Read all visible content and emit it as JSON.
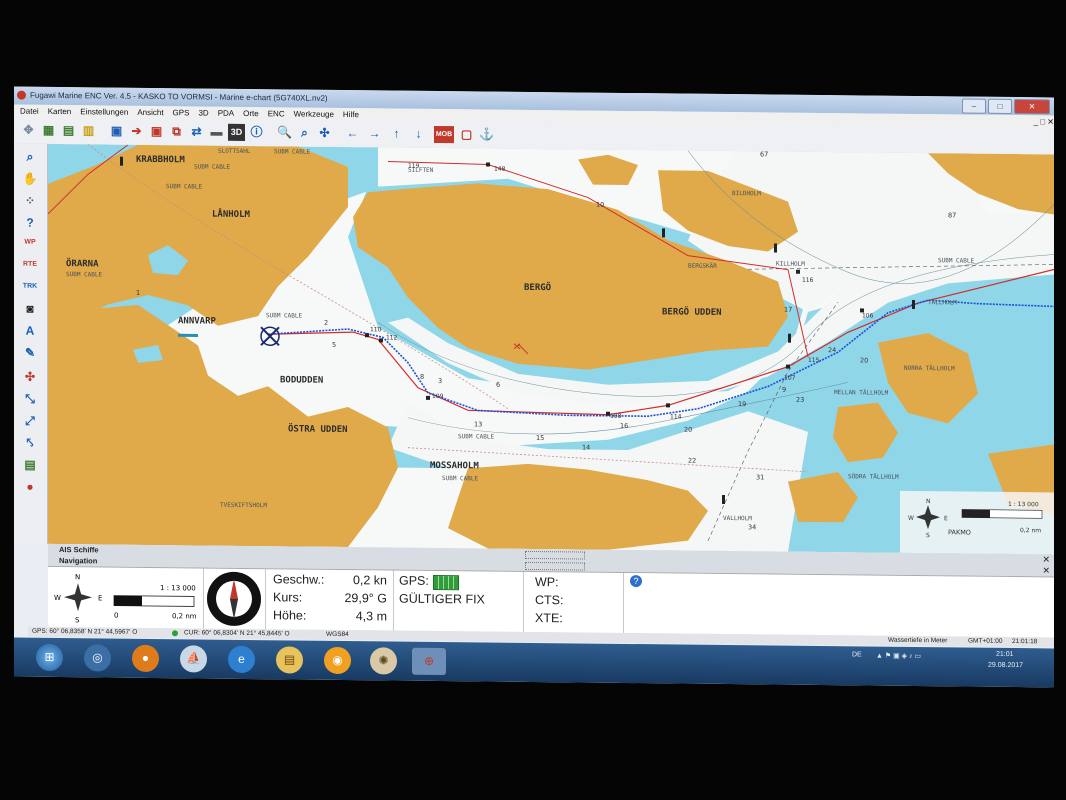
{
  "window": {
    "title": "Fugawi Marine ENC Ver. 4.5 - KASKO TO VORMSI - Marine e-chart  (5G740XL.nv2)",
    "controls": [
      "–",
      "□",
      "✕"
    ]
  },
  "menu": {
    "items": [
      "Datei",
      "Karten",
      "Einstellungen",
      "Ansicht",
      "GPS",
      "3D",
      "PDA",
      "Orte",
      "ENC",
      "Werkzeuge",
      "Hilfe"
    ],
    "right_controls": "_ □ ✕"
  },
  "toolbar": {
    "label_3d": "3D",
    "label_mob": "MOB"
  },
  "left_tools": {
    "wp": "WP",
    "rte": "RTE",
    "trk": "TRK",
    "text_tool": "A"
  },
  "chart": {
    "place_names": {
      "krabbholm": "KRABBHOLM",
      "lanholm": "LÅNHOLM",
      "orarna": "ÖRARNA",
      "annvarp": "ANNVARP",
      "bodudden": "BODUDDEN",
      "ostra_udden": "ÖSTRA UDDEN",
      "bergo": "BERGÖ",
      "bergo_udden": "BERGÖ UDDEN",
      "mossaholm": "MOSSAHOLM",
      "norra_tallholm": "NORRA TÄLLHOLM",
      "mellan_tallholm": "MELLAN TÄLLHOLM",
      "sodra_tallholm": "SÖDRA TÄLLHOLM",
      "tveskiftsholm": "TVESKIFTSHOLM",
      "vallholm": "VALLHOLM",
      "sloitsahl": "SLOTTSAHL",
      "silften": "SILFTEN",
      "bildholm": "BILDHOLM",
      "bergskar": "BERGSKÄR",
      "killholm": "KILLHOLM",
      "tallholm": "TÄLLHOLM"
    },
    "cable": "SUBM CABLE",
    "waypoints": [
      "110",
      "112",
      "109",
      "108",
      "106",
      "114",
      "107",
      "115",
      "116",
      "148",
      "119"
    ],
    "depths": [
      "1",
      "2",
      "3",
      "5",
      "6",
      "8",
      "9",
      "10",
      "13",
      "14",
      "15",
      "16",
      "17",
      "19",
      "20",
      "22",
      "23",
      "24",
      "26",
      "31",
      "34",
      "67",
      "87"
    ]
  },
  "inset": {
    "scale": "1 : 13 000",
    "distance": "0,2 nm",
    "watermark": "PAKMO",
    "compass_n": "N",
    "compass_s": "S",
    "compass_w": "W",
    "compass_e": "E"
  },
  "ais_panel": {
    "title": "AIS Schiffe"
  },
  "navigation_panel": {
    "title": "Navigation",
    "scale": "1 : 13 000",
    "scale_min": "0",
    "scale_max": "0,2 nm",
    "compass_n": "N",
    "compass_s": "S",
    "compass_w": "W",
    "compass_e": "E",
    "speed_label": "Geschw.:",
    "speed_value": "0,2 kn",
    "course_label": "Kurs:",
    "course_value": "29,9° G",
    "altitude_label": "Höhe:",
    "altitude_value": "4,3 m",
    "gps_label": "GPS:",
    "gps_status": "GÜLTIGER FIX",
    "wp_label": "WP:",
    "cts_label": "CTS:",
    "xte_label": "XTE:",
    "help": "?"
  },
  "status_bar": {
    "gps": "GPS: 60° 06,8358' N 21° 44,5967' O",
    "cursor": "CUR: 60° 06,8304' N 21° 45,8445' O",
    "datum": "WGS84",
    "depth_unit": "Wassertiefe in Meter",
    "timezone": "GMT+01:00",
    "time": "21:01:18"
  },
  "taskbar": {
    "language": "DE",
    "clock_time": "21:01",
    "clock_date": "29.08.2017"
  },
  "colors": {
    "land": "#e0a94a",
    "shallow": "#7fd0e4",
    "deep": "#f4f7f6",
    "route": "#d32c2c",
    "track": "#1f4fd6"
  }
}
